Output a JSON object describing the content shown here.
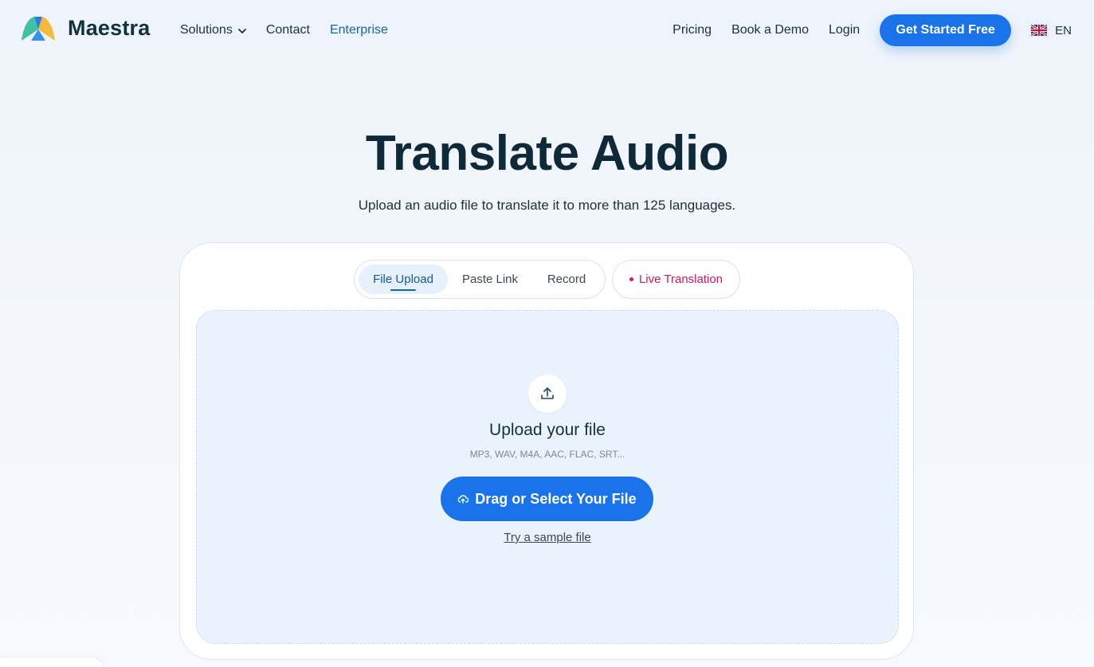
{
  "header": {
    "brand": "Maestra",
    "nav": {
      "solutions": "Solutions",
      "contact": "Contact",
      "enterprise": "Enterprise"
    },
    "right": {
      "pricing": "Pricing",
      "demo": "Book a Demo",
      "login": "Login",
      "cta": "Get Started Free",
      "language": "EN"
    }
  },
  "hero": {
    "title": "Translate Audio",
    "subtitle": "Upload an audio file to translate it to more than 125 languages."
  },
  "tabs": {
    "file_upload": "File Upload",
    "paste_link": "Paste Link",
    "record": "Record",
    "live": "Live Translation",
    "active": "File Upload"
  },
  "upload": {
    "title": "Upload your file",
    "formats": "MP3, WAV, M4A, AAC, FLAC, SRT...",
    "button": "Drag or Select Your File",
    "sample": "Try a sample file"
  },
  "colors": {
    "accent": "#1a73e8",
    "enterprise": "#1565a8",
    "live": "#d01a5b"
  }
}
